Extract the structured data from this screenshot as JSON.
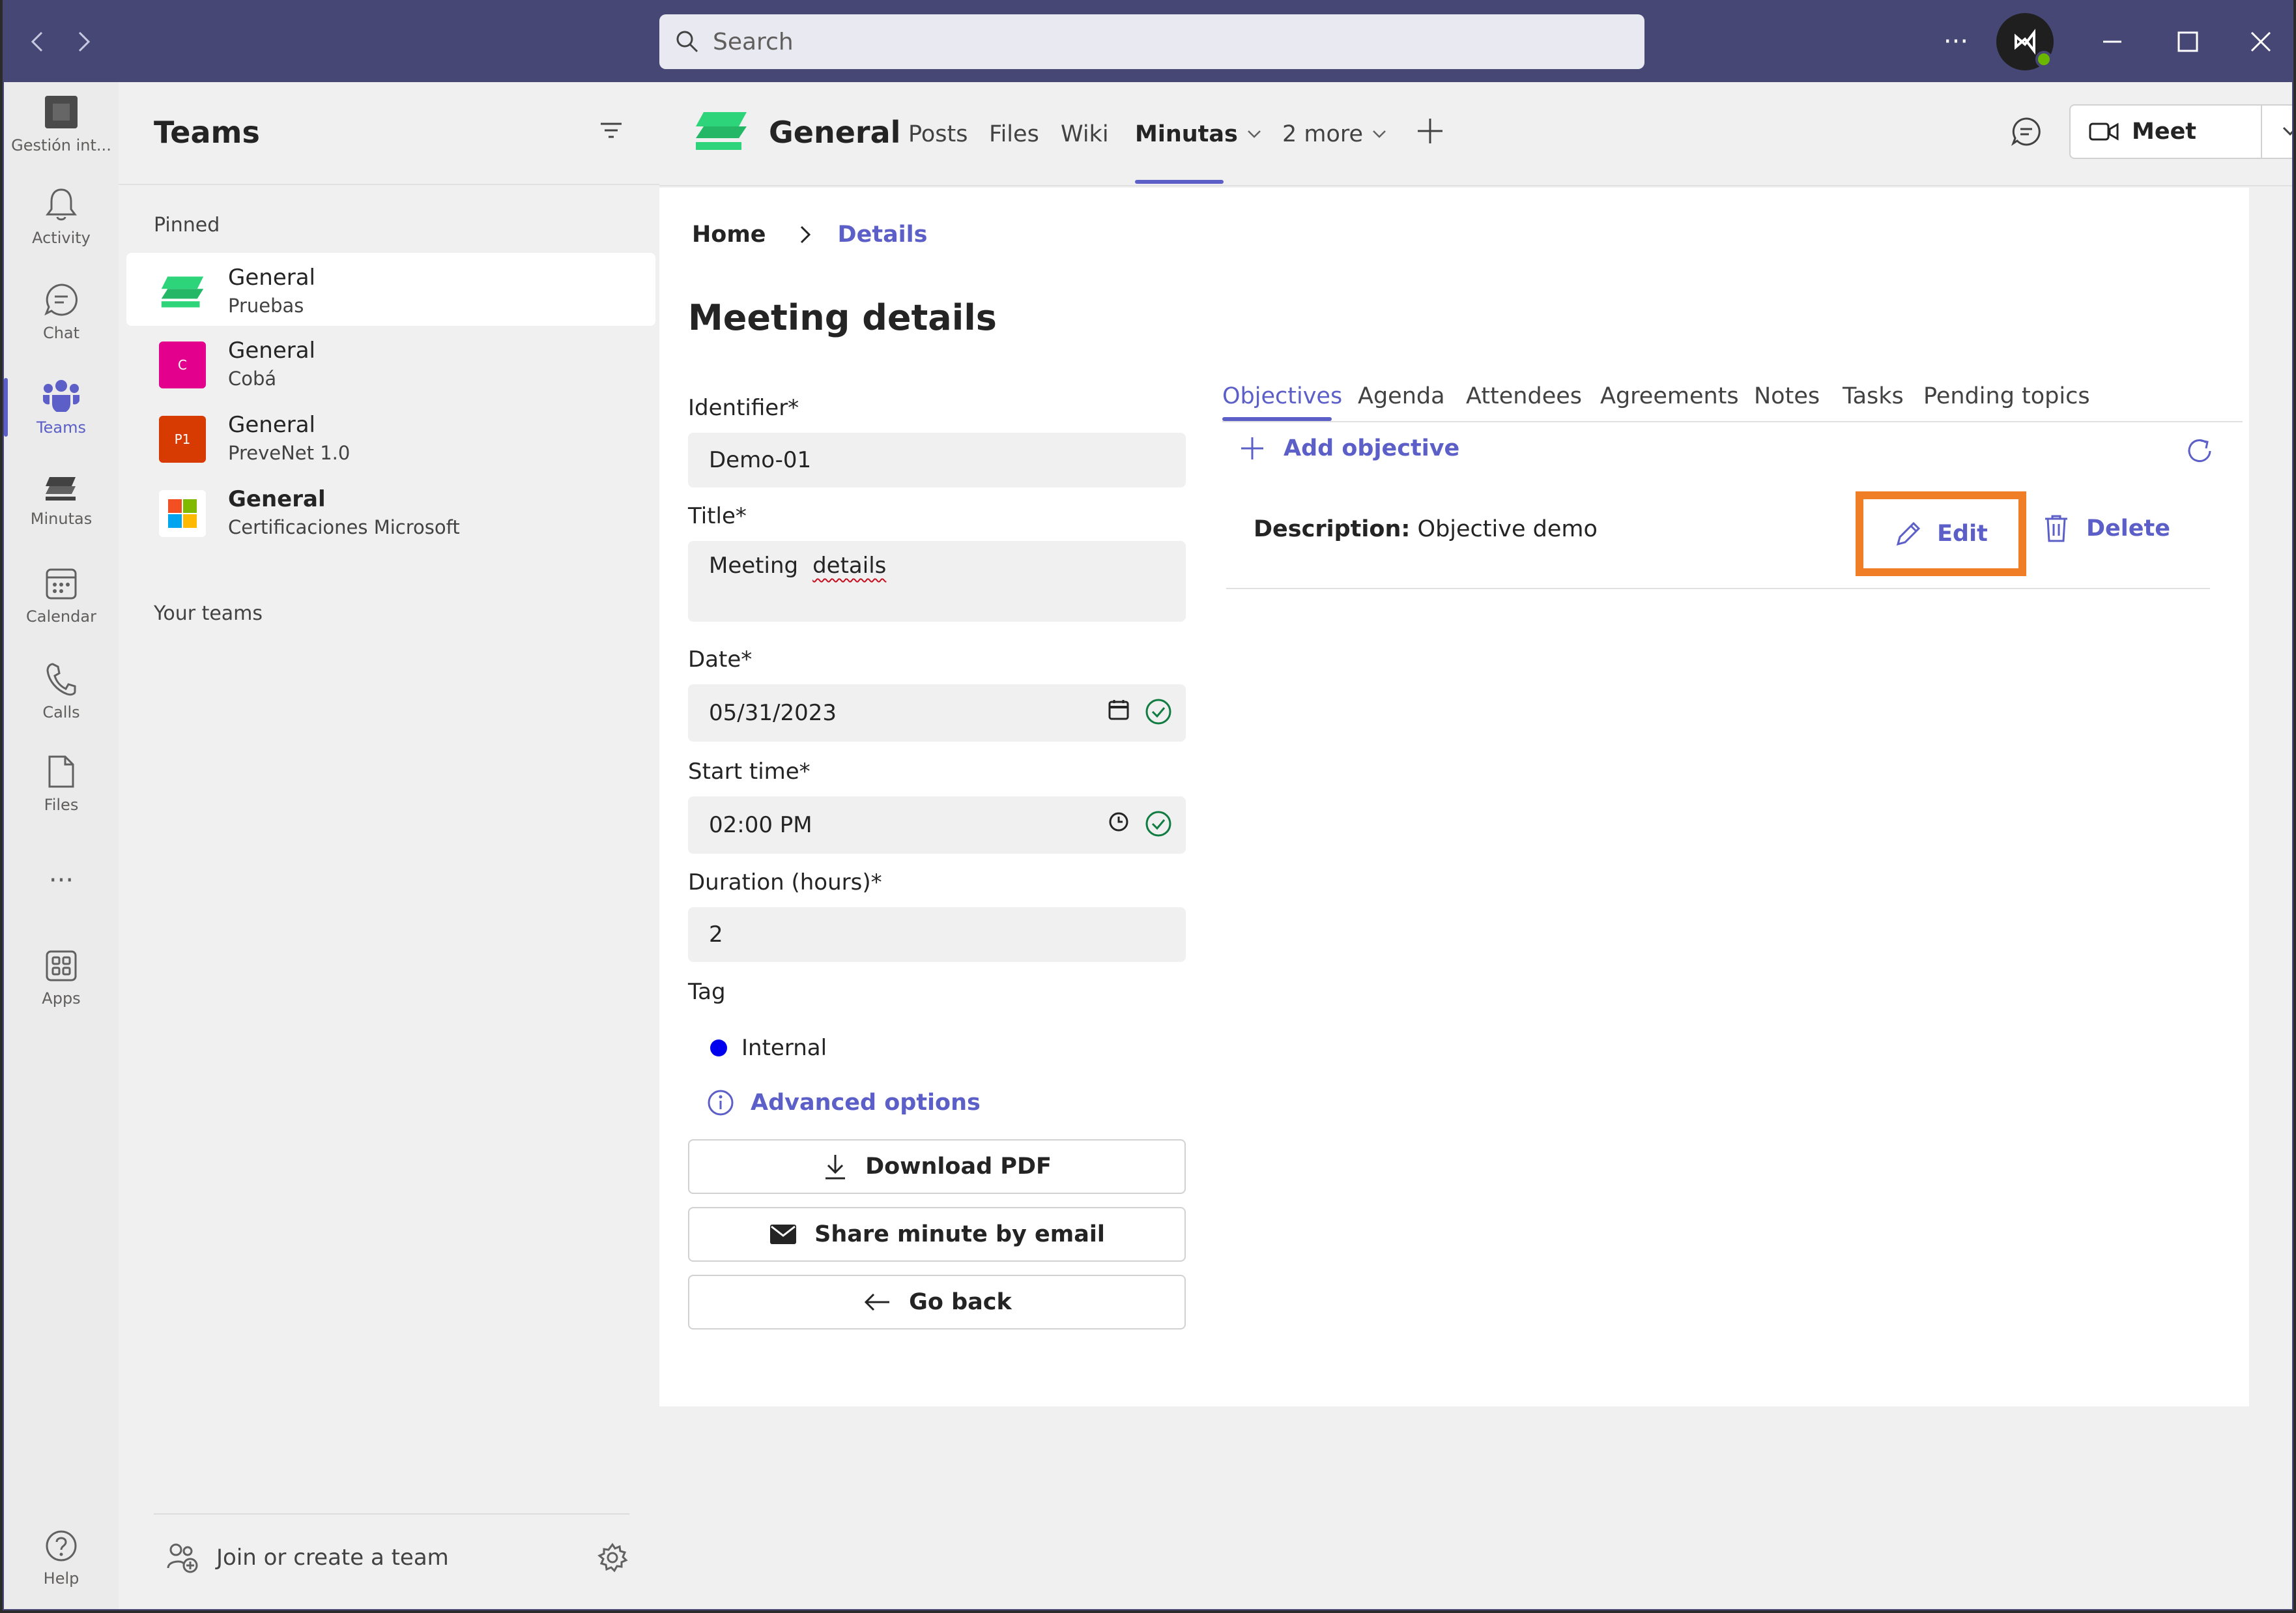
{
  "titlebar": {
    "search_placeholder": "Search",
    "more": "···"
  },
  "rail": [
    {
      "label": "Gestión int...",
      "icon": "app-icon"
    },
    {
      "label": "Activity",
      "icon": "bell-icon"
    },
    {
      "label": "Chat",
      "icon": "chat-icon"
    },
    {
      "label": "Teams",
      "icon": "teams-icon",
      "active": true
    },
    {
      "label": "Minutas",
      "icon": "minutas-icon"
    },
    {
      "label": "Calendar",
      "icon": "calendar-icon"
    },
    {
      "label": "Calls",
      "icon": "phone-icon"
    },
    {
      "label": "Files",
      "icon": "file-icon"
    },
    {
      "label": "···",
      "icon": "more-icon"
    },
    {
      "label": "Apps",
      "icon": "apps-icon"
    },
    {
      "label": "Help",
      "icon": "help-icon"
    }
  ],
  "teams_pane": {
    "title": "Teams",
    "pinned_label": "Pinned",
    "your_teams_label": "Your teams",
    "teams": [
      {
        "name": "General",
        "sub": "Pruebas",
        "selected": true
      },
      {
        "name": "General",
        "sub": "Cobá",
        "logo_text": "C",
        "color": "#e3008c"
      },
      {
        "name": "General",
        "sub": "PreveNet 1.0",
        "logo_text": "P1",
        "color": "#d83b01"
      },
      {
        "name": "General",
        "sub": "Certificaciones Microsoft"
      }
    ],
    "join_label": "Join or create a team"
  },
  "channel": {
    "title": "General",
    "tabs": [
      "Posts",
      "Files",
      "Wiki",
      "Minutas",
      "2 more"
    ],
    "meet_label": "Meet"
  },
  "breadcrumb": {
    "home": "Home",
    "current": "Details"
  },
  "page_title": "Meeting details",
  "form": {
    "identifier_label": "Identifier*",
    "identifier_value": "Demo-01",
    "title_label": "Title*",
    "title_word1": "Meeting",
    "title_word2": "details",
    "date_label": "Date*",
    "date_value": "05/31/2023",
    "start_label": "Start time*",
    "start_value": "02:00 PM",
    "duration_label": "Duration (hours)*",
    "duration_value": "2",
    "tag_label": "Tag",
    "tag_value": "Internal",
    "tag_color": "#0000ee",
    "advanced_label": "Advanced options"
  },
  "actions": {
    "download": "Download PDF",
    "share": "Share minute by email",
    "back": "Go back"
  },
  "objective_tabs": [
    "Objectives",
    "Agenda",
    "Attendees",
    "Agreements",
    "Notes",
    "Tasks",
    "Pending topics"
  ],
  "objectives": {
    "add_label": "Add objective",
    "desc_key": "Description:",
    "desc_value": "Objective demo",
    "edit_label": "Edit",
    "delete_label": "Delete"
  },
  "colors": {
    "accent": "#5b5fc7",
    "titlebar": "#464775",
    "highlight": "#f07e26"
  }
}
